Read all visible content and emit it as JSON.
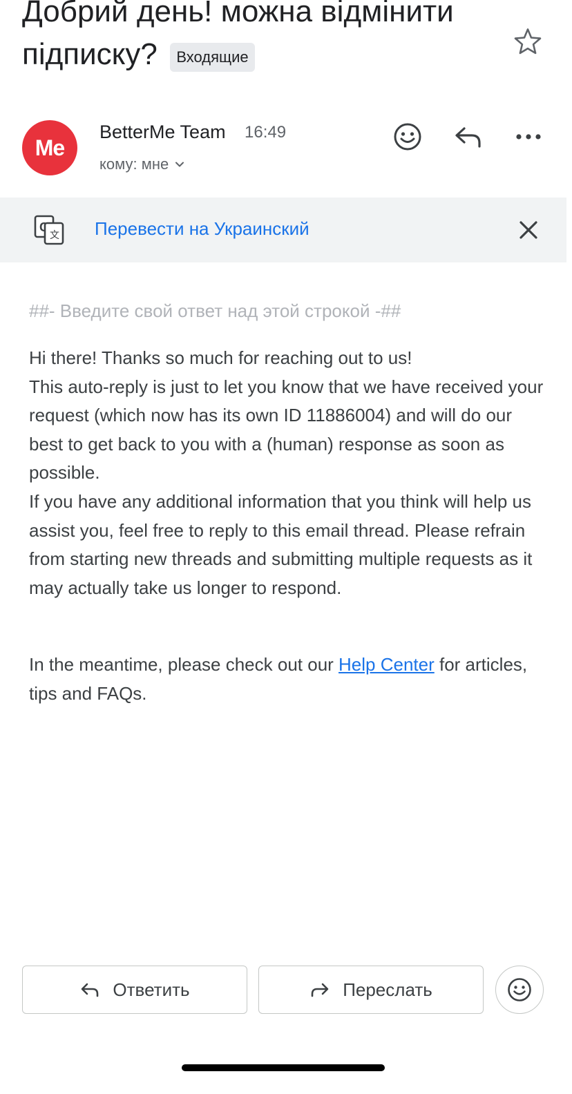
{
  "email": {
    "subject": "Добрий день! можна відмінити підписку?",
    "label": "Входящие",
    "sender": {
      "name": "BetterMe Team",
      "avatar_text": "Me",
      "avatar_color": "#e8323c"
    },
    "time": "16:49",
    "recipient": "кому: мне",
    "translate": {
      "link_text": "Перевести на Украинский"
    },
    "body": {
      "separator": "##- Введите свой ответ над этой строкой -##",
      "paragraphs": [
        "Hi there! Thanks so much for reaching out to us!",
        "This auto-reply is just to let you know that we have received your request (which now has its own ID 11886004) and will do our best to get back to you with a (human) response as soon as possible.",
        "If you have any additional information that you think will help us assist you, feel free to reply to this email thread. Please refrain from starting new threads and submitting multiple requests as it may actually take us longer to respond."
      ],
      "meantime_before": "In the meantime, please check out our ",
      "help_link": "Help Center",
      "meantime_after": " for articles, tips and FAQs."
    }
  },
  "actions": {
    "reply_label": "Ответить",
    "forward_label": "Переслать"
  },
  "icons": {
    "star": "star-outline-icon",
    "emoji": "smiley-icon",
    "reply": "reply-arrow-icon",
    "more": "more-horizontal-icon",
    "translate": "google-translate-icon",
    "close": "close-icon",
    "chevron": "chevron-down-icon",
    "forward": "forward-arrow-icon"
  },
  "colors": {
    "accent": "#1a73e8",
    "translate_bar": "#f1f3f4",
    "chip": "#e8eaed"
  }
}
